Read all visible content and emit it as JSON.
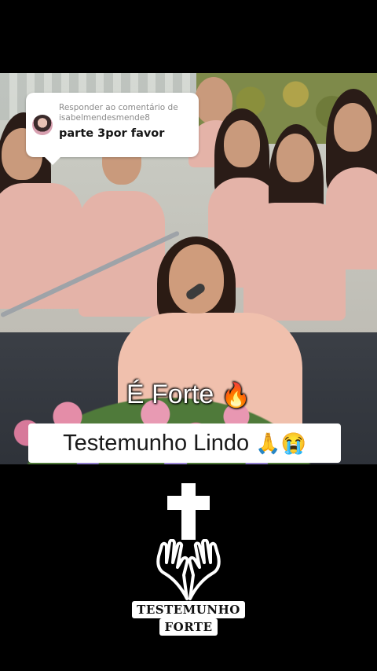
{
  "reply_bubble": {
    "label": "Responder ao comentário de",
    "username": "isabelmendesmende8",
    "comment": "parte 3por favor"
  },
  "captions": {
    "line1": "É Forte",
    "line1_emoji": "🔥",
    "line2": "Testemunho Lindo",
    "line2_emoji": "🙏😭"
  },
  "logo": {
    "line1": "TESTEMUNHO",
    "line2": "FORTE"
  },
  "icons": {
    "cross": "cross-icon",
    "hands": "praying-hands-icon"
  }
}
